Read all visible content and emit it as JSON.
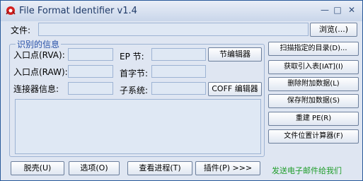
{
  "window": {
    "title": "File Format Identifier v1.4",
    "min": "—",
    "max": "□",
    "close": "✕"
  },
  "file": {
    "label": "文件:",
    "browse": "浏览(...)"
  },
  "group": {
    "title": "识别的信息"
  },
  "fields": {
    "rva": "入口点(RVA):",
    "raw": "入口点(RAW):",
    "linker": "连接器信息:",
    "ep_section": "EP 节:",
    "first_byte": "首字节:",
    "subsystem": "子系统:"
  },
  "buttons": {
    "section_editor": "节编辑器",
    "coff_editor": "COFF 编辑器",
    "scan_dir": "扫描指定的目录(D)...",
    "get_iat": "获取引入表[IAT](I)",
    "remove_overlay": "删除附加数据(L)",
    "save_overlay": "保存附加数据(S)",
    "rebuild_pe": "重建 PE(R)",
    "offset_calc": "文件位置计算器(F)",
    "unpack": "脱壳(U)",
    "options": "选项(O)",
    "view_process": "查看进程(T)",
    "plugins": "插件(P) >>>"
  },
  "email": "发送电子邮件给我们",
  "colors": {
    "accent": "#1f9d2a",
    "group_title": "#2851a8",
    "icon_red": "#d42020"
  }
}
